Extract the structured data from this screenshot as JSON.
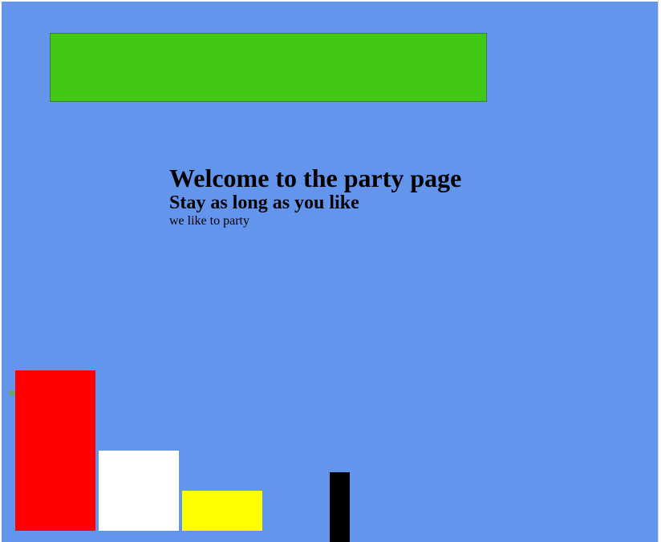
{
  "content": {
    "heading": "Welcome to the party page",
    "subheading": "Stay as long as you like",
    "tagline": "we like to party"
  },
  "colors": {
    "page_background": "#6495ed",
    "banner": "#41c815",
    "block_red": "#ff0000",
    "block_white": "#ffffff",
    "block_yellow": "#ffff00",
    "block_black": "#000000"
  }
}
